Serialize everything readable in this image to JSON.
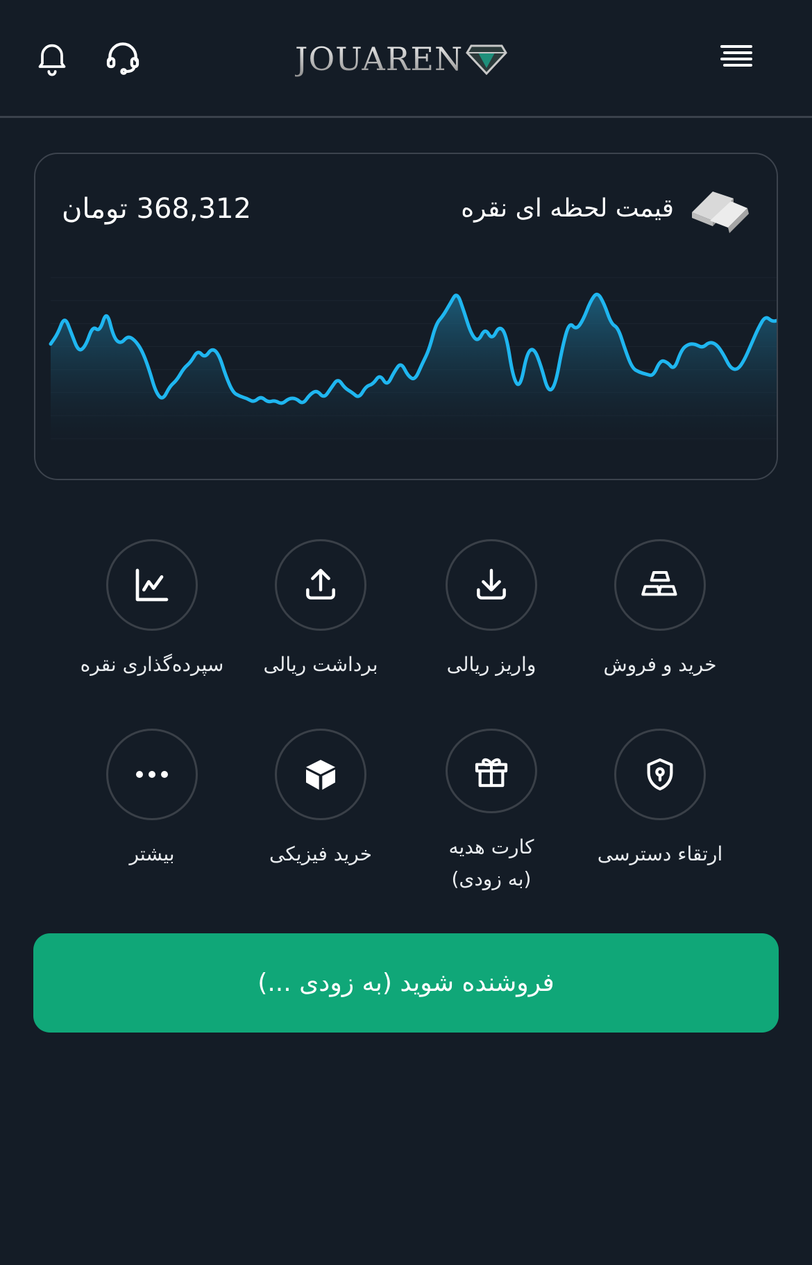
{
  "header": {
    "brand": "JOUAREN",
    "icons": [
      "menu-icon",
      "support-headset-icon",
      "bell-icon"
    ]
  },
  "price_card": {
    "title": "قیمت لحظه ای نقره",
    "value": "368,312 تومان",
    "icon": "silver-bars-icon",
    "accent_color": "#1fb6f0"
  },
  "chart_data": {
    "type": "line",
    "x": [
      0,
      1,
      2,
      3,
      4,
      5,
      6,
      7,
      8,
      9,
      10,
      11,
      12,
      13,
      14,
      15,
      16,
      17,
      18,
      19,
      20,
      21,
      22,
      23,
      24,
      25,
      26,
      27,
      28,
      29,
      30,
      31,
      32,
      33,
      34,
      35,
      36,
      37,
      38,
      39,
      40,
      41,
      42,
      43,
      44,
      45,
      46,
      47,
      48,
      49,
      50,
      51,
      52,
      53,
      54,
      55,
      56,
      57,
      58,
      59,
      60,
      61,
      62,
      63,
      64,
      65,
      66,
      67,
      68,
      69,
      70,
      71,
      72,
      73,
      74,
      75,
      76,
      77,
      78,
      79,
      80,
      81,
      82,
      83,
      84,
      85,
      86,
      87,
      88,
      89,
      90,
      91,
      92,
      93,
      94,
      95,
      96,
      97,
      98,
      99,
      100,
      101,
      102,
      103,
      104,
      105,
      106,
      107,
      108,
      109,
      110,
      111,
      112,
      113,
      114,
      115,
      116,
      117,
      118,
      119
    ],
    "values": [
      47,
      52,
      61,
      52,
      43,
      46,
      56,
      53,
      64,
      50,
      47,
      51,
      49,
      44,
      35,
      23,
      19,
      26,
      29,
      35,
      38,
      44,
      40,
      45,
      42,
      31,
      23,
      21,
      20,
      18,
      21,
      18,
      19,
      17,
      20,
      20,
      17,
      22,
      24,
      20,
      25,
      30,
      25,
      23,
      20,
      26,
      27,
      32,
      26,
      33,
      38,
      31,
      29,
      37,
      44,
      57,
      61,
      67,
      73,
      63,
      52,
      48,
      55,
      49,
      56,
      52,
      30,
      25,
      43,
      45,
      36,
      23,
      26,
      45,
      58,
      54,
      59,
      68,
      73,
      67,
      57,
      55,
      44,
      35,
      33,
      32,
      31,
      39,
      38,
      34,
      44,
      47,
      47,
      45,
      48,
      47,
      42,
      35,
      34,
      39,
      47,
      55,
      61,
      58,
      59
    ]
  },
  "actions": [
    {
      "label": "خرید و فروش",
      "icon": "gold-bars-icon"
    },
    {
      "label": "واریز ریالی",
      "icon": "download-icon"
    },
    {
      "label": "برداشت ریالی",
      "icon": "upload-icon"
    },
    {
      "label": "سپرده‌گذاری نقره",
      "icon": "line-chart-icon"
    },
    {
      "label": "ارتقاء دسترسی",
      "icon": "shield-keyhole-icon"
    },
    {
      "label": "کارت هدیه\n(به زودی)",
      "icon": "gift-icon"
    },
    {
      "label": "خرید فیزیکی",
      "icon": "box-icon"
    },
    {
      "label": "بیشتر",
      "icon": "more-dots-icon"
    }
  ],
  "cta": {
    "label": "فروشنده شوید (به زودی ...)",
    "color": "#10a778"
  }
}
